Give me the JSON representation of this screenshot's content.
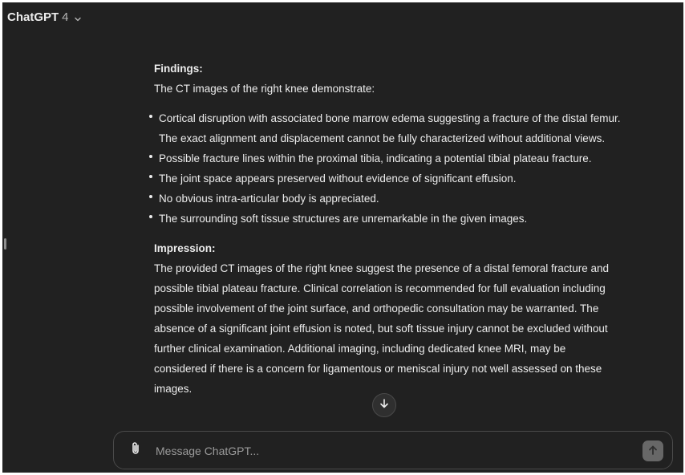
{
  "header": {
    "model_name": "ChatGPT",
    "model_version": "4",
    "chevron_icon": "chevron-down-icon"
  },
  "message": {
    "findings_heading": "Findings:",
    "findings_intro": "The CT images of the right knee demonstrate:",
    "bullets": [
      {
        "lines": [
          "Cortical disruption with associated bone marrow edema suggesting a fracture of the distal femur.",
          "The exact alignment and displacement cannot be fully characterized without additional views."
        ]
      },
      {
        "lines": [
          "Possible fracture lines within the proximal tibia, indicating a potential tibial plateau fracture."
        ]
      },
      {
        "lines": [
          "The joint space appears preserved without evidence of significant effusion."
        ]
      },
      {
        "lines": [
          "No obvious intra-articular body is appreciated."
        ]
      },
      {
        "lines": [
          "The surrounding soft tissue structures are unremarkable in the given images."
        ]
      }
    ],
    "impression_heading": "Impression:",
    "impression_lines": [
      "The provided CT images of the right knee suggest the presence of a distal femoral fracture and",
      "possible tibial plateau fracture. Clinical correlation is recommended for full evaluation including",
      "possible involvement of the joint surface, and orthopedic consultation may be warranted. The",
      "absence of a significant joint effusion is noted, but soft tissue injury cannot be excluded without",
      "further clinical examination. Additional imaging, including dedicated knee MRI, may be",
      "considered if there is a concern for ligamentous or meniscal injury not well assessed on these",
      "images."
    ]
  },
  "scroll_button": {
    "icon": "arrow-down-icon"
  },
  "composer": {
    "placeholder": "Message ChatGPT...",
    "attach_icon": "paperclip-icon",
    "send_icon": "arrow-up-icon"
  },
  "colors": {
    "background": "#212121",
    "text": "#ececec",
    "muted_text": "#9b9b9b",
    "border": "#4a4a4a",
    "send_button": "#676767"
  }
}
